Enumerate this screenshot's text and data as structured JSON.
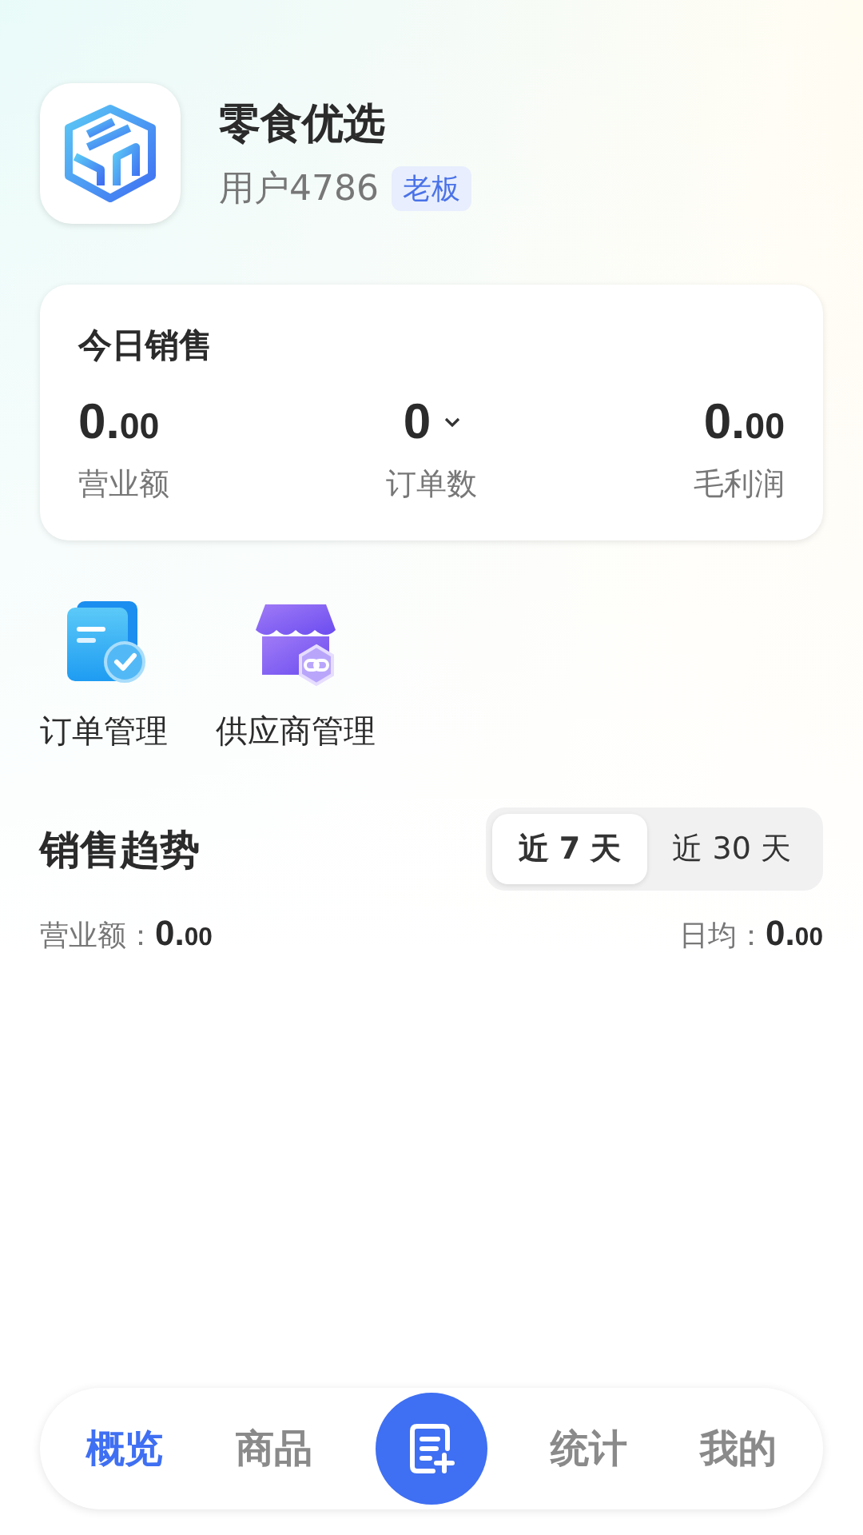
{
  "profile": {
    "store_name": "零食优选",
    "user": "用户4786",
    "role_badge": "老板"
  },
  "today_sales": {
    "title": "今日销售",
    "metrics": [
      {
        "main": "0.",
        "fraction": "00",
        "label": "营业额",
        "dropdown": false
      },
      {
        "main": "0",
        "label": "订单数",
        "dropdown": true
      },
      {
        "main": "0.",
        "fraction": "00",
        "label": "毛利润",
        "dropdown": false
      }
    ]
  },
  "shortcuts": [
    {
      "label": "订单管理",
      "kind": "orders"
    },
    {
      "label": "供应商管理",
      "kind": "suppliers"
    }
  ],
  "sales_trend": {
    "title": "销售趋势",
    "ranges": [
      {
        "label": "近 7 天",
        "selected": true
      },
      {
        "label": "近 30 天",
        "selected": false
      }
    ],
    "stats": [
      {
        "label": "营业额：",
        "main": "0.",
        "fraction": "00"
      },
      {
        "label": "日均：",
        "main": "0.",
        "fraction": "00"
      }
    ]
  },
  "bottom_nav": [
    {
      "kind": "tab",
      "label": "概览",
      "selected": true
    },
    {
      "kind": "tab",
      "label": "商品",
      "selected": false
    },
    {
      "kind": "action"
    },
    {
      "kind": "tab",
      "label": "统计",
      "selected": false
    },
    {
      "kind": "tab",
      "label": "我的",
      "selected": false
    }
  ]
}
